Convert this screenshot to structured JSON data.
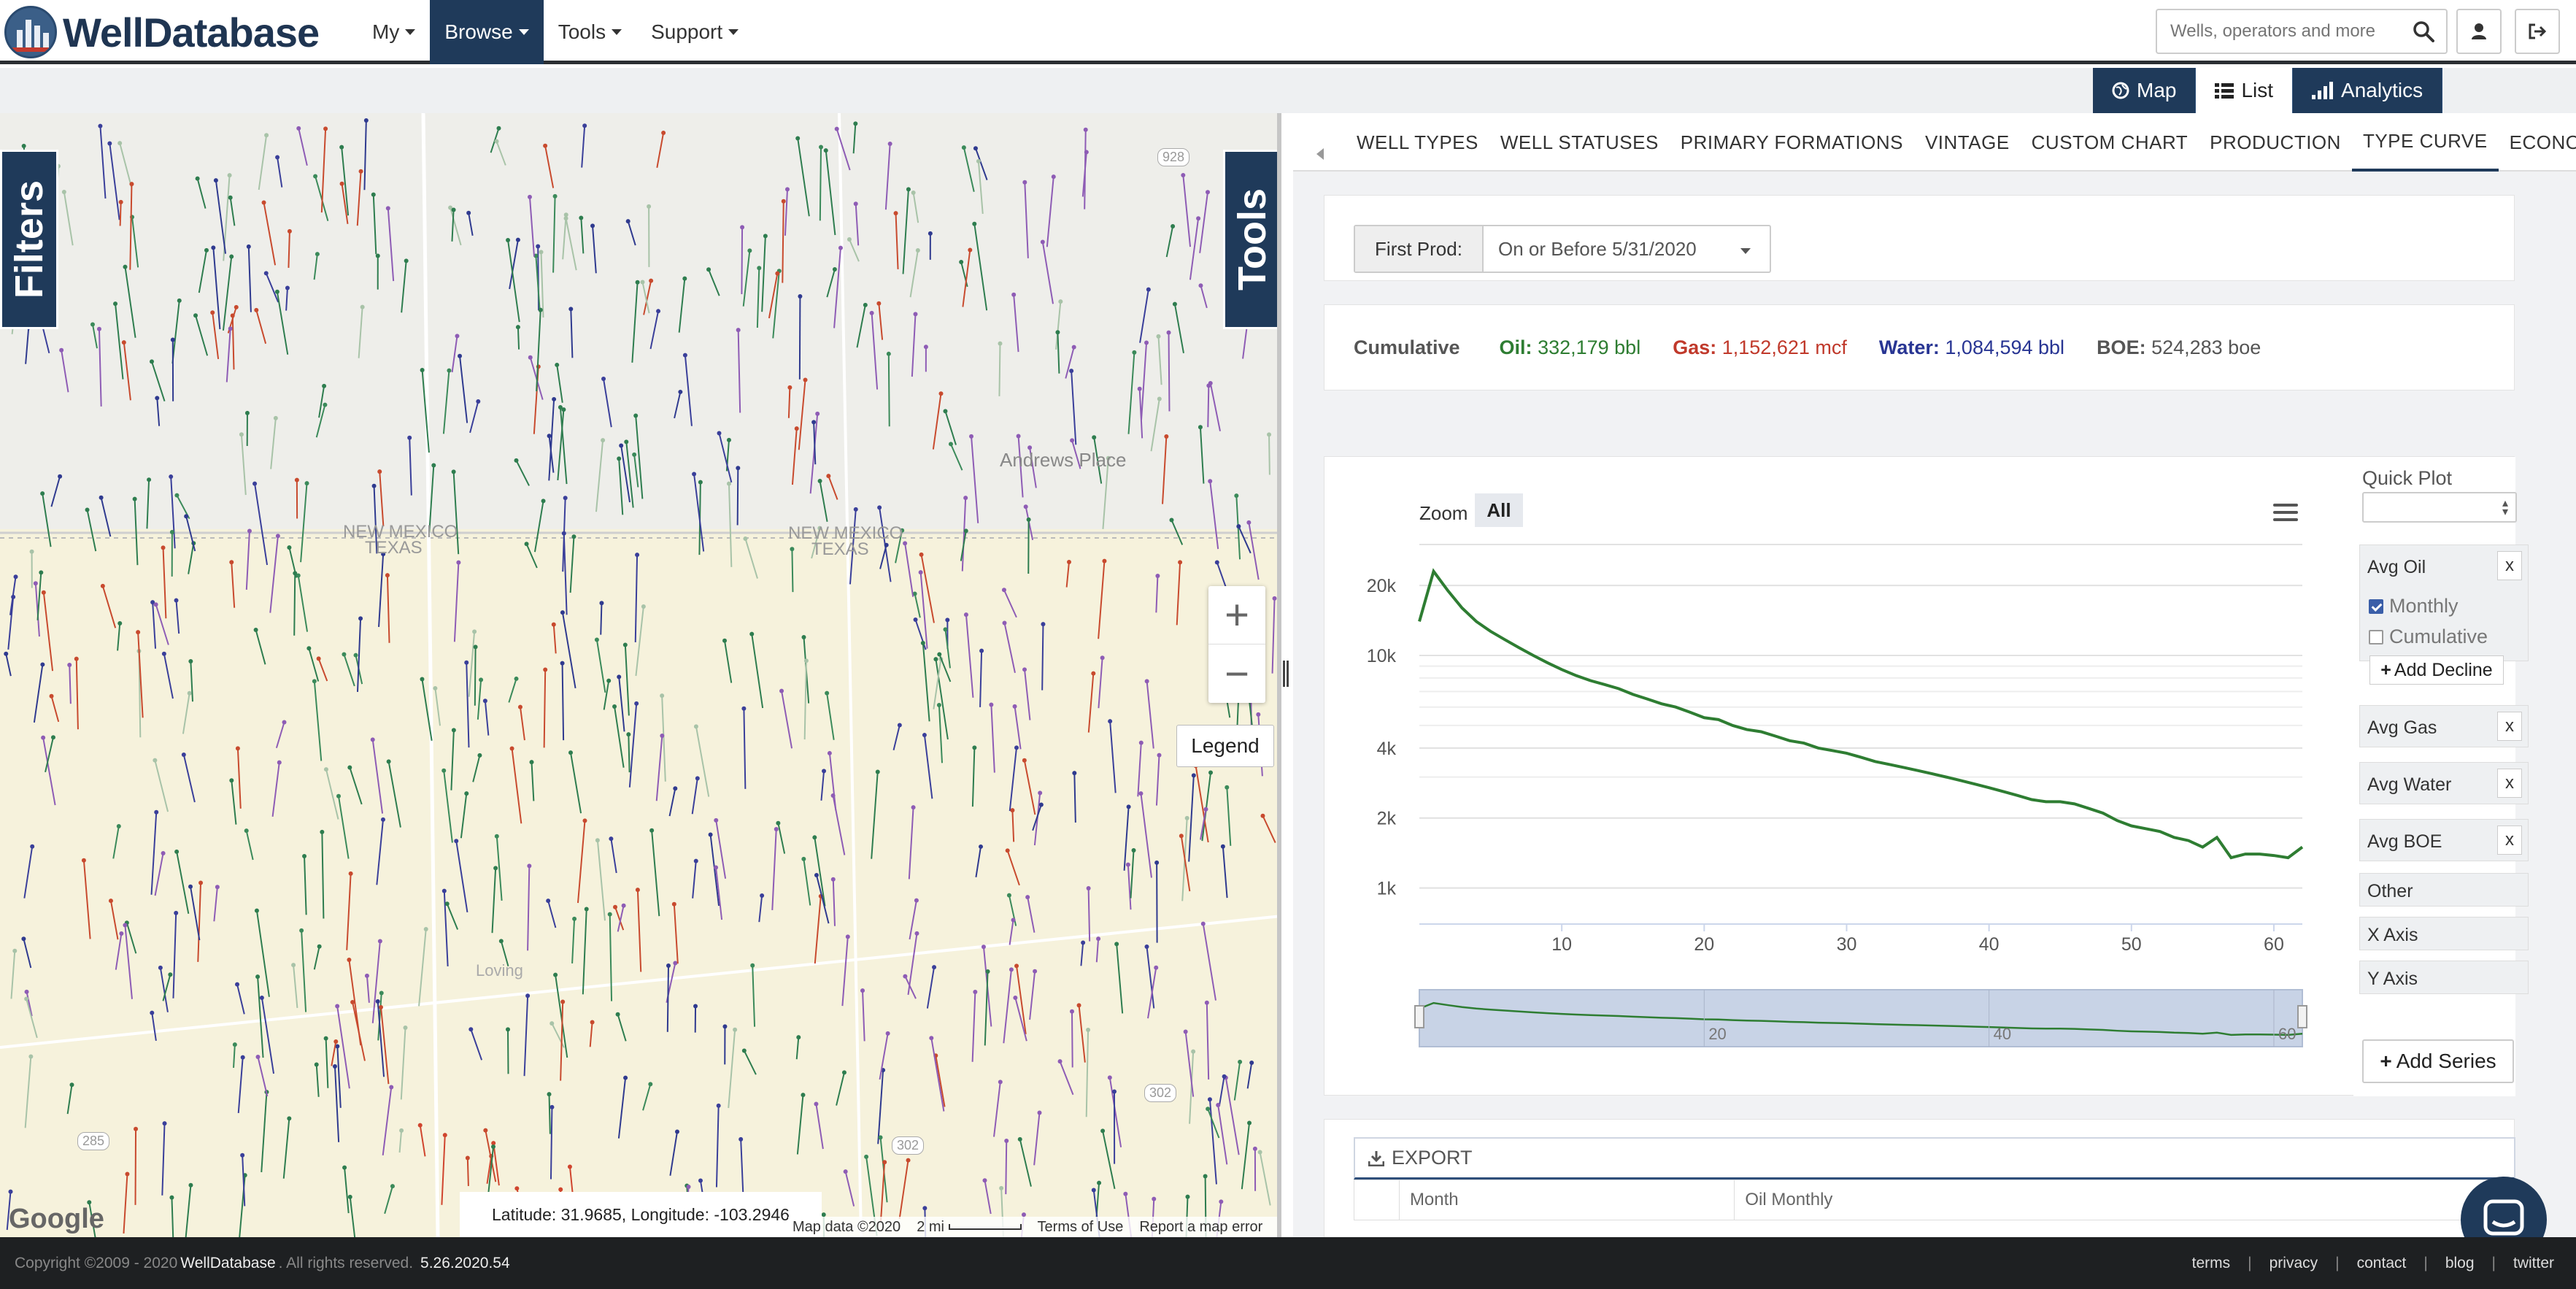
{
  "header": {
    "brand": "WellDatabase",
    "menu": [
      {
        "label": "My",
        "active": false
      },
      {
        "label": "Browse",
        "active": true
      },
      {
        "label": "Tools",
        "active": false
      },
      {
        "label": "Support",
        "active": false
      }
    ],
    "search_placeholder": "Wells, operators and more"
  },
  "viewbar": {
    "map_label": "Map",
    "list_label": "List",
    "analytics_label": "Analytics"
  },
  "map": {
    "filters_tab": "Filters",
    "tools_tab": "Tools",
    "zoom_in": "+",
    "zoom_out": "−",
    "legend": "Legend",
    "labels": {
      "new_mexico": "NEW MEXICO",
      "texas": "TEXAS",
      "new_mexico_2": "NEW MEXICO",
      "texas_2": "TEXAS",
      "andrews_place": "Andrews Place",
      "loving": "Loving",
      "road_928": "928",
      "road_285": "285",
      "road_302": "302",
      "road_302_b": "302"
    },
    "coordinates": "Latitude: 31.9685, Longitude: -103.2946",
    "map_data": "Map data ©2020",
    "scale": "2 mi",
    "terms": "Terms of Use",
    "report": "Report a map error",
    "google": "Google"
  },
  "tabs": [
    "WELL TYPES",
    "WELL STATUSES",
    "PRIMARY FORMATIONS",
    "VINTAGE",
    "CUSTOM CHART",
    "PRODUCTION",
    "TYPE CURVE",
    "ECONOMICS"
  ],
  "active_tab": "TYPE CURVE",
  "first_prod": {
    "label": "First Prod:",
    "value": "On or Before 5/31/2020"
  },
  "cumulative": {
    "title": "Cumulative",
    "oil_label": "Oil:",
    "oil_value": "332,179 bbl",
    "gas_label": "Gas:",
    "gas_value": "1,152,621 mcf",
    "water_label": "Water:",
    "water_value": "1,084,594 bbl",
    "boe_label": "BOE:",
    "boe_value": "524,283 boe",
    "colors": {
      "oil": "#2e7d32",
      "gas": "#c0392b",
      "water": "#283593"
    }
  },
  "chart": {
    "zoom_label": "Zoom",
    "zoom_all": "All"
  },
  "chart_data": {
    "type": "line",
    "scale": "log-y",
    "xlim": [
      0,
      62
    ],
    "ylim": [
      700,
      30000
    ],
    "x_ticks": [
      10,
      20,
      30,
      40,
      50,
      60
    ],
    "y_ticks": [
      1000,
      2000,
      4000,
      10000,
      20000
    ],
    "y_tick_labels": [
      "1k",
      "2k",
      "4k",
      "10k",
      "20k"
    ],
    "navigator_ticks": [
      "20",
      "40",
      "60"
    ],
    "series": [
      {
        "name": "Avg Oil",
        "color": "#2e7d32",
        "x": [
          0,
          1,
          2,
          3,
          4,
          5,
          6,
          7,
          8,
          9,
          10,
          11,
          12,
          13,
          14,
          15,
          16,
          17,
          18,
          19,
          20,
          21,
          22,
          23,
          24,
          25,
          26,
          27,
          28,
          29,
          30,
          31,
          32,
          33,
          34,
          35,
          36,
          37,
          38,
          39,
          40,
          41,
          42,
          43,
          44,
          45,
          46,
          47,
          48,
          49,
          50,
          51,
          52,
          53,
          54,
          55,
          56,
          57,
          58,
          59,
          60,
          61,
          62
        ],
        "y": [
          14000,
          23000,
          19000,
          16000,
          14000,
          12700,
          11700,
          10800,
          10000,
          9300,
          8700,
          8200,
          7800,
          7500,
          7200,
          6800,
          6500,
          6200,
          6000,
          5700,
          5400,
          5300,
          5000,
          4800,
          4700,
          4500,
          4300,
          4200,
          4000,
          3900,
          3800,
          3650,
          3500,
          3400,
          3300,
          3200,
          3100,
          3000,
          2900,
          2800,
          2700,
          2600,
          2500,
          2400,
          2350,
          2350,
          2300,
          2200,
          2100,
          1950,
          1850,
          1800,
          1750,
          1650,
          1600,
          1500,
          1650,
          1350,
          1400,
          1400,
          1380,
          1350,
          1500
        ]
      }
    ]
  },
  "quick_plot": {
    "title": "Quick Plot",
    "avg_oil": "Avg Oil",
    "monthly": "Monthly",
    "monthly_checked": true,
    "cumulative": "Cumulative",
    "cumulative_checked": false,
    "add_decline": "Add Decline",
    "avg_gas": "Avg Gas",
    "avg_water": "Avg Water",
    "avg_boe": "Avg BOE",
    "other": "Other",
    "x_axis": "X Axis",
    "y_axis": "Y Axis",
    "add_series": "Add Series",
    "remove": "x"
  },
  "export": {
    "label": "EXPORT",
    "columns": [
      "",
      "Month",
      "Oil Monthly"
    ]
  },
  "footer": {
    "copyright": "Copyright ©2009 - 2020",
    "brand": "WellDatabase",
    "rights": ". All rights reserved.",
    "version": "5.26.2020.54",
    "links": [
      "terms",
      "privacy",
      "contact",
      "blog",
      "twitter"
    ]
  }
}
